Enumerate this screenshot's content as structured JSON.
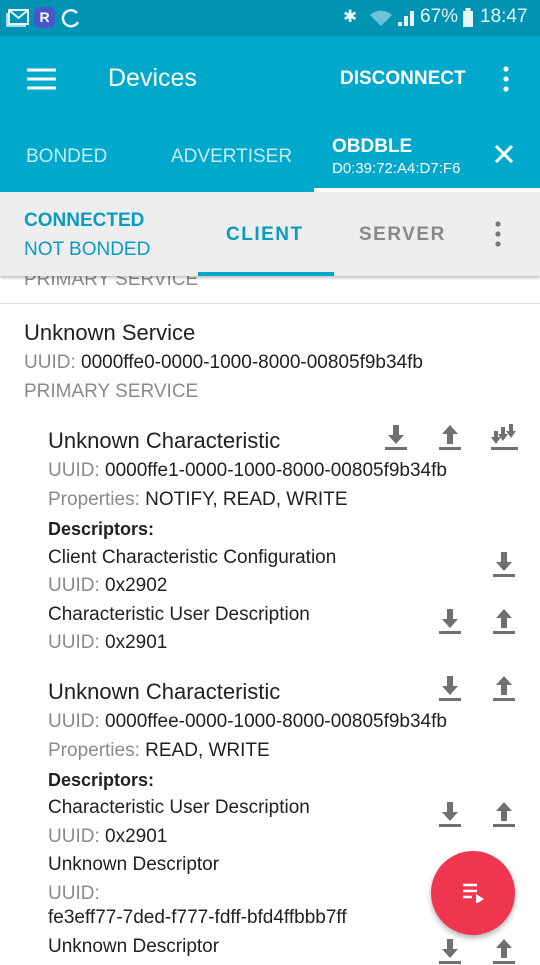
{
  "status_bar": {
    "battery": "67%",
    "time": "18:47",
    "icons": [
      "mail-icon",
      "r-app-icon",
      "sync-icon",
      "bluetooth-icon",
      "wifi-icon",
      "signal-icon",
      "battery-icon"
    ]
  },
  "toolbar": {
    "title": "Devices",
    "disconnect": "DISCONNECT",
    "tabs": [
      {
        "label": "BONDED"
      },
      {
        "label": "ADVERTISER"
      },
      {
        "label": "OBDBLE",
        "sub": "D0:39:72:A4:D7:F6"
      }
    ]
  },
  "connection": {
    "state": "CONNECTED",
    "bond": "NOT BONDED",
    "tabs": [
      "CLIENT",
      "SERVER"
    ]
  },
  "colors": {
    "primary": "#00a8cc",
    "accent": "#f0354f",
    "status": "#0093b4"
  },
  "content": {
    "prev_service_type": "PRIMARY SERVICE",
    "service": {
      "name": "Unknown Service",
      "uuid_label": "UUID:",
      "uuid": "0000ffe0-0000-1000-8000-00805f9b34fb",
      "type": "PRIMARY SERVICE"
    },
    "characteristics": [
      {
        "name": "Unknown Characteristic",
        "uuid_label": "UUID:",
        "uuid": "0000ffe1-0000-1000-8000-00805f9b34fb",
        "props_label": "Properties:",
        "props": "NOTIFY, READ, WRITE",
        "desc_label": "Descriptors:",
        "descriptors": [
          {
            "name": "Client Characteristic Configuration",
            "uuid_label": "UUID:",
            "uuid": "0x2902"
          },
          {
            "name": "Characteristic User Description",
            "uuid_label": "UUID:",
            "uuid": "0x2901"
          }
        ]
      },
      {
        "name": "Unknown Characteristic",
        "uuid_label": "UUID:",
        "uuid": "0000ffee-0000-1000-8000-00805f9b34fb",
        "props_label": "Properties:",
        "props": "READ, WRITE",
        "desc_label": "Descriptors:",
        "descriptors": [
          {
            "name": "Characteristic User Description",
            "uuid_label": "UUID:",
            "uuid": "0x2901"
          },
          {
            "name": "Unknown Descriptor",
            "uuid_label": "UUID:",
            "uuid": "fe3eff77-7ded-f777-fdff-bfd4ffbbb7ff"
          },
          {
            "name": "Unknown Descriptor"
          }
        ]
      }
    ]
  }
}
